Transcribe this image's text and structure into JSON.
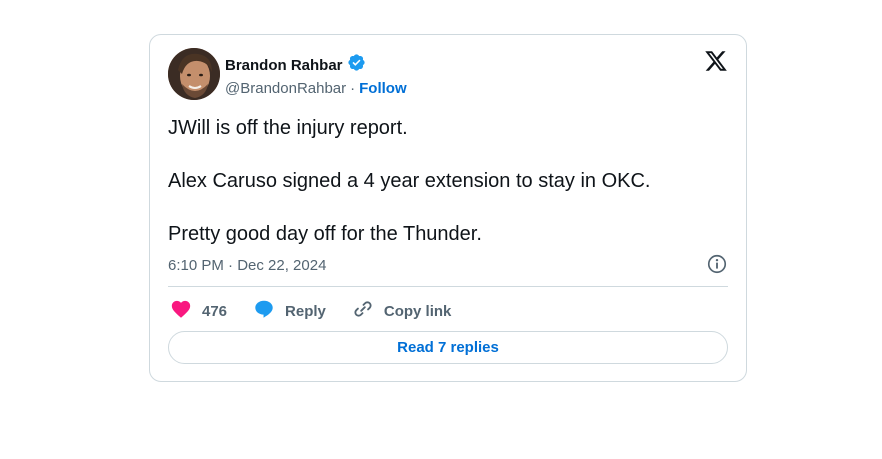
{
  "author": {
    "display_name": "Brandon Rahbar",
    "handle": "@BrandonRahbar",
    "separator": "·",
    "follow_label": "Follow",
    "verified_icon": "verified-badge-icon",
    "verified_color": "#1d9bf0"
  },
  "tweet": {
    "lines": [
      "JWill is off the injury report.",
      "Alex Caruso signed a 4 year extension to stay in OKC.",
      "Pretty good day off for the Thunder."
    ],
    "timestamp": "6:10 PM · Dec 22, 2024"
  },
  "actions": {
    "likes_count": "476",
    "reply_label": "Reply",
    "copy_link_label": "Copy link",
    "like_color": "#f91880",
    "reply_color": "#1d9bf0"
  },
  "footer": {
    "read_replies_label": "Read 7 replies"
  },
  "colors": {
    "link": "#006fd6",
    "muted": "#536471",
    "border": "#cfd9de"
  }
}
